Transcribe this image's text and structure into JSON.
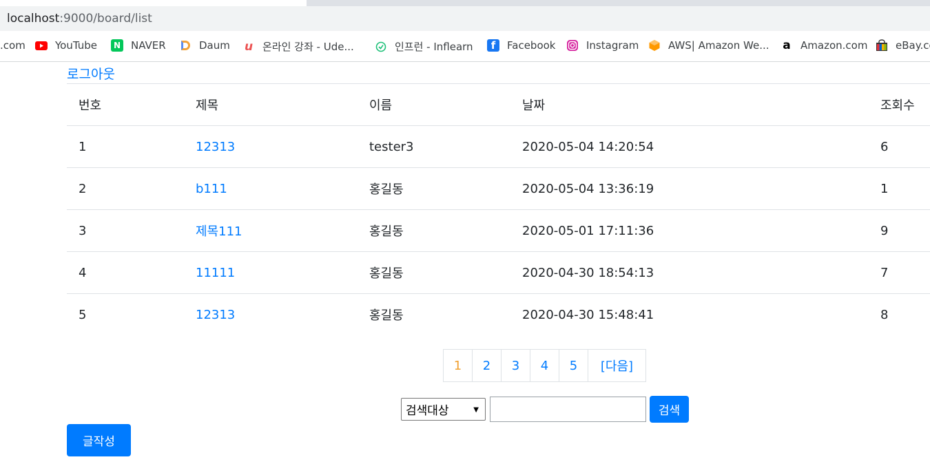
{
  "browser": {
    "url_host": "localhost",
    "url_rest": ":9000/board/list"
  },
  "bookmarks": [
    {
      "label": ".com",
      "icon": "none"
    },
    {
      "label": "YouTube",
      "icon": "youtube-icon",
      "color": "#ff0000"
    },
    {
      "label": "NAVER",
      "icon": "naver-icon",
      "color": "#03c75a"
    },
    {
      "label": "Daum",
      "icon": "daum-icon",
      "color": "#f2a33a"
    },
    {
      "label": "온라인 강좌 - Ude...",
      "icon": "udemy-icon",
      "color": "#ec5252"
    },
    {
      "label": "인프런 - Inflearn",
      "icon": "inflearn-icon",
      "color": "#1dc078"
    },
    {
      "label": "Facebook",
      "icon": "facebook-icon",
      "color": "#1877f2"
    },
    {
      "label": "Instagram",
      "icon": "instagram-icon",
      "color": "#d6249f"
    },
    {
      "label": "AWS| Amazon We...",
      "icon": "aws-icon",
      "color": "#ff9900"
    },
    {
      "label": "Amazon.com",
      "icon": "amazon-icon",
      "color": "#000000"
    },
    {
      "label": "eBay.com",
      "icon": "ebay-icon",
      "color": "#e53238"
    }
  ],
  "page": {
    "logout_label": "로그아웃",
    "table": {
      "headers": [
        "번호",
        "제목",
        "이름",
        "날짜",
        "조회수"
      ],
      "rows": [
        {
          "no": "1",
          "title": "12313",
          "name": "tester3",
          "date": "2020-05-04 14:20:54",
          "views": "6"
        },
        {
          "no": "2",
          "title": "b111",
          "name": "홍길동",
          "date": "2020-05-04 13:36:19",
          "views": "1"
        },
        {
          "no": "3",
          "title": "제목111",
          "name": "홍길동",
          "date": "2020-05-01 17:11:36",
          "views": "9"
        },
        {
          "no": "4",
          "title": "11111",
          "name": "홍길동",
          "date": "2020-04-30 18:54:13",
          "views": "7"
        },
        {
          "no": "5",
          "title": "12313",
          "name": "홍길동",
          "date": "2020-04-30 15:48:41",
          "views": "8"
        }
      ]
    },
    "pagination": {
      "pages": [
        "1",
        "2",
        "3",
        "4",
        "5"
      ],
      "current": "1",
      "next_label": "[다음]"
    },
    "search": {
      "select_value": "검색대상",
      "input_value": "",
      "button_label": "검색"
    },
    "write_label": "글작성",
    "colors": {
      "link": "#007bff",
      "current_page": "#f0a030",
      "button": "#007bff"
    }
  }
}
